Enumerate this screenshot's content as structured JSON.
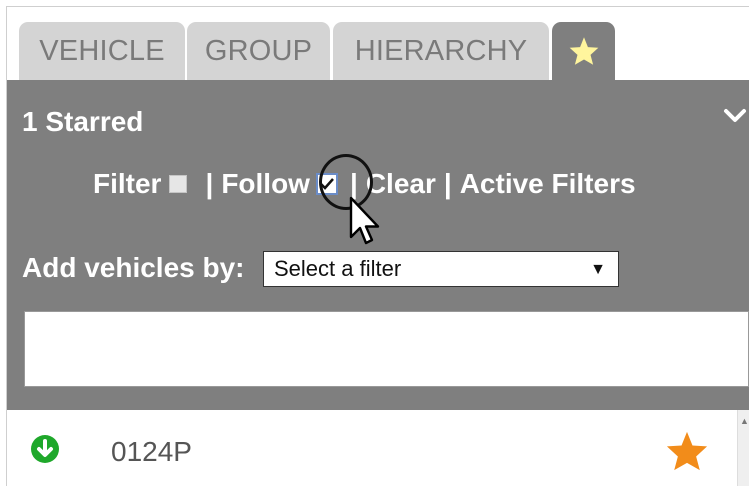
{
  "tabs": [
    {
      "label": "VEHICLE"
    },
    {
      "label": "GROUP"
    },
    {
      "label": "HIERARCHY"
    },
    {
      "label": "",
      "icon": "star-icon",
      "active": true
    }
  ],
  "panel": {
    "header": "1 Starred",
    "controls": {
      "filter_label": "Filter",
      "filter_checked": false,
      "follow_label": "Follow",
      "follow_checked": true,
      "separator": "|",
      "clear_label": "Clear",
      "active_filters_label": "Active Filters"
    },
    "add_by_label": "Add vehicles by:",
    "select_value": "Select a filter"
  },
  "vehicles": [
    {
      "id": "0124P",
      "status_icon": "down-arrow-circle-icon",
      "starred": true
    }
  ],
  "colors": {
    "panel": "#7f7f7f",
    "tab_inactive": "#d4d4d4",
    "star_tab": "#fff59d",
    "star_row": "#f28c1a",
    "status_green": "#1fa82b"
  }
}
